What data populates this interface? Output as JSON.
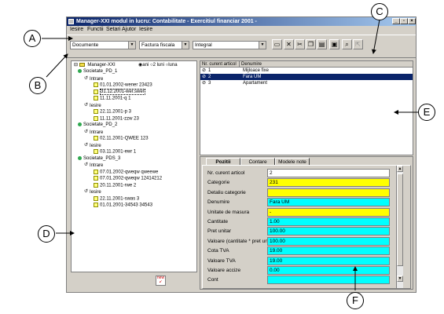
{
  "window": {
    "title": "Manager-XXI   modul in lucru:  Contabilitate   - Exercitiul financiar 2001 -",
    "buttons": {
      "minimize": "_",
      "maximize": "▫",
      "close": "×"
    }
  },
  "menubar": {
    "items": [
      "Iesire",
      "Functii",
      "Setari",
      "Ajutor",
      "Iesire"
    ]
  },
  "toolbar": {
    "combo1": "Documente",
    "combo2": "Factura fiscala",
    "combo3": "Integral"
  },
  "tree": {
    "root": "Manager-XXI",
    "radio_labels": [
      "ani",
      "2 luni",
      "luna"
    ],
    "rows": [
      {
        "level": 1,
        "icon": "green",
        "text": "Societate_PD_1"
      },
      {
        "level": 2,
        "icon": "arrow",
        "text": "Intrare"
      },
      {
        "level": 3,
        "icon": "doc",
        "text": "01.01.2002-wener 23423"
      },
      {
        "level": 3,
        "icon": "doc",
        "text": "31.12.2001-wer.swer",
        "selected": true
      },
      {
        "level": 3,
        "icon": "doc",
        "text": "11.11.2001-q 1"
      },
      {
        "level": 2,
        "icon": "arrow",
        "text": "Iesire"
      },
      {
        "level": 3,
        "icon": "doc",
        "text": "22.11.2001-p 3"
      },
      {
        "level": 3,
        "icon": "doc",
        "text": "11.11.2001-zzw 23"
      },
      {
        "level": 1,
        "icon": "green",
        "text": "Societate_PD_2"
      },
      {
        "level": 2,
        "icon": "arrow",
        "text": "Intrare"
      },
      {
        "level": 3,
        "icon": "doc",
        "text": "02.11.2001-QWEE 123"
      },
      {
        "level": 2,
        "icon": "arrow",
        "text": "Iesire"
      },
      {
        "level": 3,
        "icon": "doc",
        "text": "03.11.2001-ewr 1"
      },
      {
        "level": 1,
        "icon": "green",
        "text": "Societate_PDS_3"
      },
      {
        "level": 2,
        "icon": "arrow",
        "text": "Intrare"
      },
      {
        "level": 3,
        "icon": "doc",
        "text": "07.01.2002-qweqw qweewe"
      },
      {
        "level": 3,
        "icon": "doc",
        "text": "07.01.2002-qweqw 12414212"
      },
      {
        "level": 3,
        "icon": "doc",
        "text": "20.11.2001-rwe 2"
      },
      {
        "level": 2,
        "icon": "arrow",
        "text": "Iesire"
      },
      {
        "level": 3,
        "icon": "doc",
        "text": "22.11.2001-swas 3"
      },
      {
        "level": 3,
        "icon": "doc",
        "text": "01.01.2001-34543 34543"
      }
    ]
  },
  "grid": {
    "headers": [
      "Nr. curent articol",
      "Denumire"
    ],
    "rows": [
      {
        "nr": "1",
        "den": "Mijloace fixe"
      },
      {
        "nr": "2",
        "den": "Fara UM",
        "selected": true
      },
      {
        "nr": "3",
        "den": "Apartament"
      }
    ]
  },
  "tabs": {
    "items": [
      "Pozitii",
      "Contare",
      "Modele note"
    ]
  },
  "form": {
    "fields": [
      {
        "label": "Nr. curent articol",
        "value": "2",
        "color": "#ffffff"
      },
      {
        "label": "Categorie",
        "value": "231",
        "color": "#ffff00"
      },
      {
        "label": "Detaliu categorie",
        "value": "",
        "color": "#ffff00"
      },
      {
        "label": "Denumire",
        "value": "Fara UM",
        "color": "#00ffff"
      },
      {
        "label": "Unitate de masura",
        "value": "-",
        "color": "#ffff00"
      },
      {
        "label": "Cantitate",
        "value": "1.00",
        "color": "#00ffff"
      },
      {
        "label": "Pret unitar",
        "value": "100.00",
        "color": "#00ffff"
      },
      {
        "label": "Valoare (cantitate * pret unitar)",
        "value": "100.00",
        "color": "#00ffff"
      },
      {
        "label": "Cota TVA",
        "value": "19.00",
        "color": "#00ffff"
      },
      {
        "label": "Valoare TVA",
        "value": "19.00",
        "color": "#00ffff"
      },
      {
        "label": "Valoare accize",
        "value": "0.00",
        "color": "#00ffff"
      },
      {
        "label": "Cont",
        "value": "",
        "color": "#00ffff"
      }
    ]
  },
  "callouts": [
    "A",
    "B",
    "C",
    "D",
    "E",
    "F"
  ]
}
